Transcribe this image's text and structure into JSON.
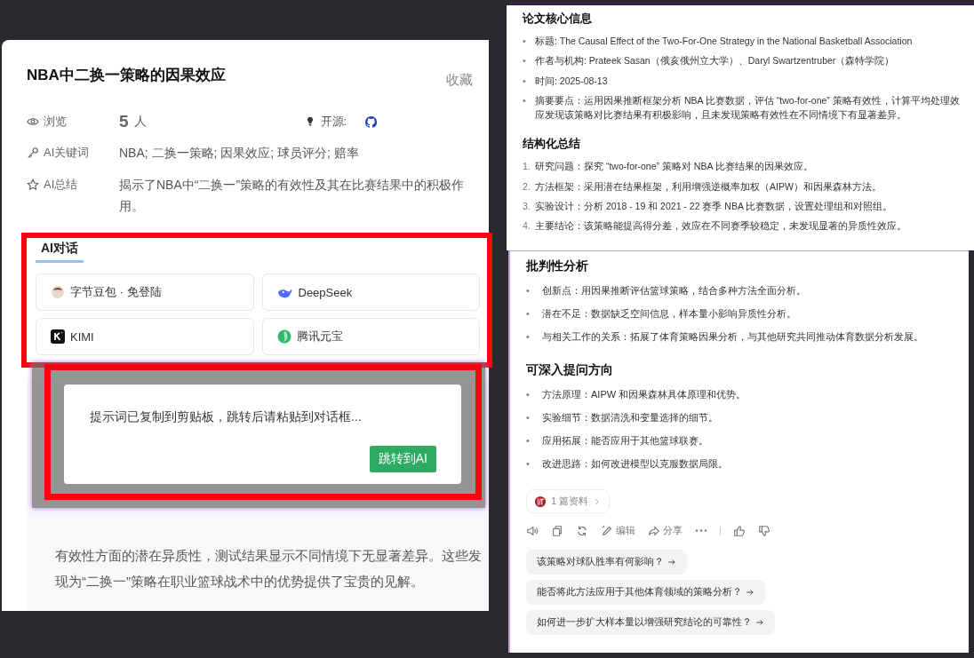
{
  "paper": {
    "title": "NBA中二换一策略的因果效应",
    "favorite": "收藏",
    "views": {
      "label": "浏览",
      "count": "5",
      "unit": "人"
    },
    "open_source": {
      "label": "开源:"
    },
    "keywords": {
      "label": "AI关键词",
      "value": "NBA; 二换一策略; 因果效应; 球员评分; 赔率"
    },
    "summary": {
      "label": "AI总结",
      "value": "揭示了NBA中“二换一”策略的有效性及其在比赛结果中的积极作用。"
    }
  },
  "ai_chat": {
    "tab": "AI对话",
    "options": [
      {
        "kind": "doubao",
        "label": "字节豆包 · 免登陆"
      },
      {
        "kind": "deepseek",
        "label": "DeepSeek"
      },
      {
        "kind": "kimi",
        "label": "KIMI"
      },
      {
        "kind": "yuanbao",
        "label": "腾讯元宝"
      }
    ]
  },
  "abstract": {
    "text": "有效性方面的潜在异质性，测试结果显示不同情境下无显著差异。这些发现为“二换一”策略在职业篮球战术中的优势提供了宝贵的见解。"
  },
  "modal": {
    "message": "提示词已复制到剪贴板，跳转后请粘贴到对话框...",
    "button": "跳转到AI"
  },
  "summary_top": {
    "sections": [
      {
        "heading": "论文核心信息",
        "items": [
          {
            "marker": "•",
            "text": "标题: The Causal Effect of the Two-For-One Strategy in the National Basketball Association"
          },
          {
            "marker": "•",
            "text": "作者与机构: Prateek Sasan（俄亥俄州立大学）、Daryl Swartzentruber（森特学院）"
          },
          {
            "marker": "•",
            "text": "时间: 2025-08-13"
          },
          {
            "marker": "•",
            "text": "摘要要点：运用因果推断框架分析 NBA 比赛数据，评估 “two-for-one” 策略有效性，计算平均处理效应发现该策略对比赛结果有积极影响，且未发现策略有效性在不同情境下有显著差异。"
          }
        ]
      },
      {
        "heading": "结构化总结",
        "items": [
          {
            "marker": "1.",
            "text": "研究问题：探究 “two-for-one” 策略对 NBA 比赛结果的因果效应。"
          },
          {
            "marker": "2.",
            "text": "方法框架：采用潜在结果框架，利用增强逆概率加权（AIPW）和因果森林方法。"
          },
          {
            "marker": "3.",
            "text": "实验设计：分析 2018 - 19 和 2021 - 22 赛季 NBA 比赛数据，设置处理组和对照组。"
          },
          {
            "marker": "4.",
            "text": "主要结论：该策略能提高得分差，效应在不同赛季较稳定，未发现显著的异质性效应。"
          }
        ]
      }
    ]
  },
  "summary_bottom": {
    "sections": [
      {
        "heading": "批判性分析",
        "items": [
          {
            "marker": "•",
            "text": "创新点：用因果推断评估篮球策略，结合多种方法全面分析。"
          },
          {
            "marker": "•",
            "text": "潜在不足：数据缺乏空间信息，样本量小影响异质性分析。"
          },
          {
            "marker": "•",
            "text": "与相关工作的关系：拓展了体育策略因果分析，与其他研究共同推动体育数据分析发展。"
          }
        ]
      },
      {
        "heading": "可深入提问方向",
        "items": [
          {
            "marker": "•",
            "text": "方法原理：AIPW 和因果森林具体原理和优势。"
          },
          {
            "marker": "•",
            "text": "实验细节：数据清洗和变量选择的细节。"
          },
          {
            "marker": "•",
            "text": "应用拓展：能否应用于其他篮球联赛。"
          },
          {
            "marker": "•",
            "text": "改进思路：如何改进模型以克服数据局限。"
          }
        ]
      }
    ],
    "sources": "1 篇资料",
    "actions": [
      {
        "kind": "speaker"
      },
      {
        "kind": "copy"
      },
      {
        "kind": "refresh"
      },
      {
        "kind": "edit",
        "label": "编辑"
      },
      {
        "kind": "share",
        "label": "分享"
      },
      {
        "kind": "more"
      },
      {
        "kind": "divider"
      },
      {
        "kind": "like"
      },
      {
        "kind": "dislike"
      }
    ],
    "suggestions": [
      "该策略对球队胜率有何影响？",
      "能否将此方法应用于其他体育领域的策略分析？",
      "如何进一步扩大样本量以增强研究结论的可靠性？"
    ]
  }
}
